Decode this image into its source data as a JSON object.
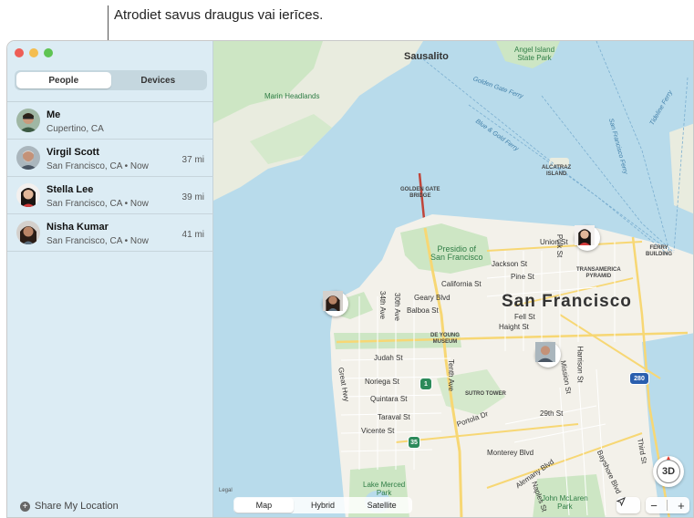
{
  "callout": {
    "text": "Atrodiet savus draugus vai ierīces."
  },
  "sidebar": {
    "tabs": [
      {
        "label": "People",
        "active": true
      },
      {
        "label": "Devices",
        "active": false
      }
    ],
    "people": [
      {
        "name": "Me",
        "location": "Cupertino, CA",
        "distance": ""
      },
      {
        "name": "Virgil Scott",
        "location": "San Francisco, CA • Now",
        "distance": "37 mi"
      },
      {
        "name": "Stella Lee",
        "location": "San Francisco, CA • Now",
        "distance": "39 mi"
      },
      {
        "name": "Nisha Kumar",
        "location": "San Francisco, CA • Now",
        "distance": "41 mi"
      }
    ],
    "share_label": "Share My Location"
  },
  "map": {
    "city": "San Francisco",
    "places": {
      "sausalito": "Sausalito",
      "angel_island": "Angel Island\nState Park",
      "marin": "Marin Headlands",
      "golden_gate_ferry": "Golden Gate Ferry",
      "blue_gold": "Blue & Gold Ferry",
      "sf_ferry": "San Francisco Ferry",
      "tideline": "Tideline Ferry",
      "alcatraz": "ALCATRAZ\nISLAND",
      "ggbridge": "GOLDEN GATE\nBRIDGE",
      "presidio": "Presidio of\nSan Francisco",
      "ferry_building": "FERRY\nBUILDING",
      "transamerica": "TRANSAMERICA\nPYRAMID",
      "union": "Union St",
      "jackson": "Jackson St",
      "pine": "Pine St",
      "california": "California St",
      "geary": "Geary Blvd",
      "balboa": "Balboa St",
      "fell": "Fell St",
      "haight": "Haight St",
      "de_young": "DE YOUNG\nMUSEUM",
      "judah": "Judah St",
      "noriega": "Noriega St",
      "quintara": "Quintara St",
      "taraval": "Taraval St",
      "vicente": "Vicente St",
      "sutro": "SUTRO TOWER",
      "portola": "Portola Dr",
      "st29": "29th St",
      "monterey": "Monterey Blvd",
      "alemany": "Alemany Blvd",
      "lake_merced": "Lake Merced\nPark",
      "mclaren": "John McLaren\nPark",
      "polk": "Polk St",
      "ave30": "30th Ave",
      "ave34": "34th Ave",
      "tenth": "Tenth Ave",
      "great_hwy": "Great Hwy",
      "harrison": "Harrison St",
      "mission": "Mission St",
      "third": "Third St",
      "bayshore": "Bayshore Blvd",
      "naples": "Naples St",
      "legal": "Legal"
    },
    "shields": {
      "hwy1": "1",
      "hwy35": "35",
      "i280": "280"
    },
    "map_types": [
      {
        "label": "Map",
        "active": true
      },
      {
        "label": "Hybrid",
        "active": false
      },
      {
        "label": "Satellite",
        "active": false
      }
    ],
    "btn_3d": "3D",
    "zoom_out": "−",
    "zoom_in": "+"
  },
  "colors": {
    "water": "#b8dbeb",
    "land": "#f3f1ea",
    "park": "#cde6c4",
    "road_major": "#f7d774",
    "sidebar": "#dcecf4"
  }
}
